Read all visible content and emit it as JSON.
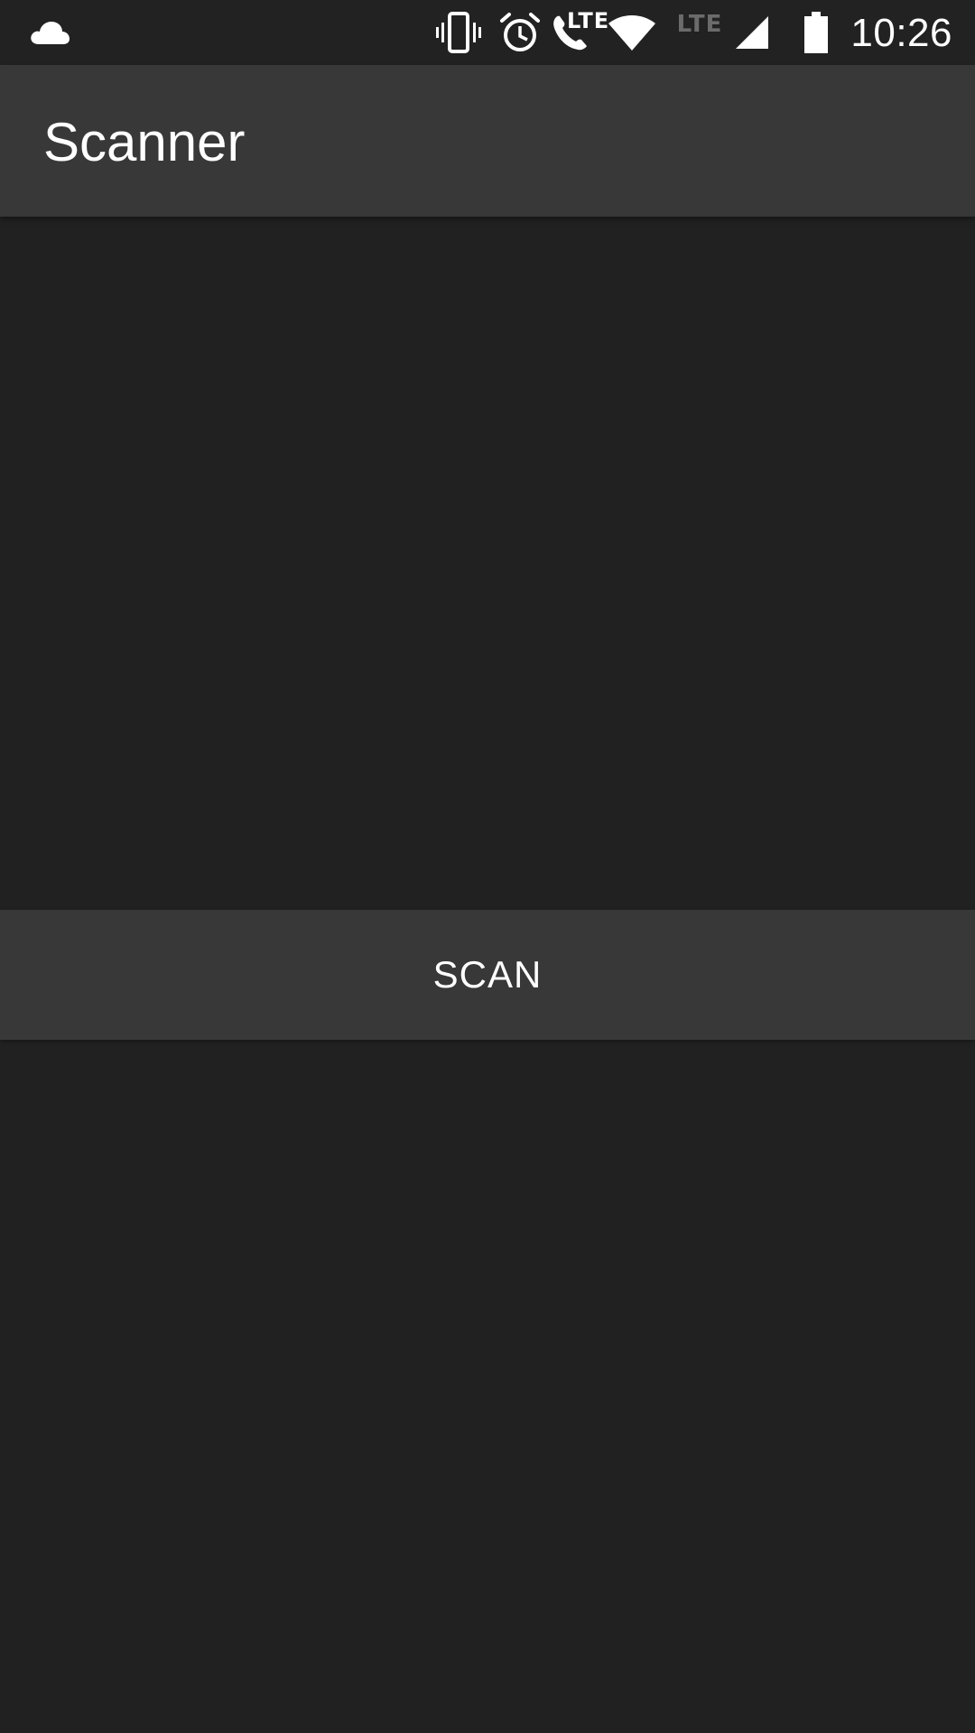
{
  "status_bar": {
    "time": "10:26",
    "call_lte_label": "LTE",
    "data_lte_label": "LTE",
    "icons": [
      "cloud-icon",
      "vibrate-icon",
      "alarm-icon",
      "lte-call-icon",
      "wifi-icon",
      "lte-data-icon",
      "cell-signal-icon",
      "battery-icon"
    ],
    "colors": {
      "background": "#222222",
      "icon": "#ffffff",
      "dim_icon": "#6b6b6b"
    }
  },
  "app_bar": {
    "title": "Scanner",
    "background": "#383838"
  },
  "main": {
    "scan_button_label": "SCAN",
    "background": "#212121",
    "button_background": "#383838"
  }
}
